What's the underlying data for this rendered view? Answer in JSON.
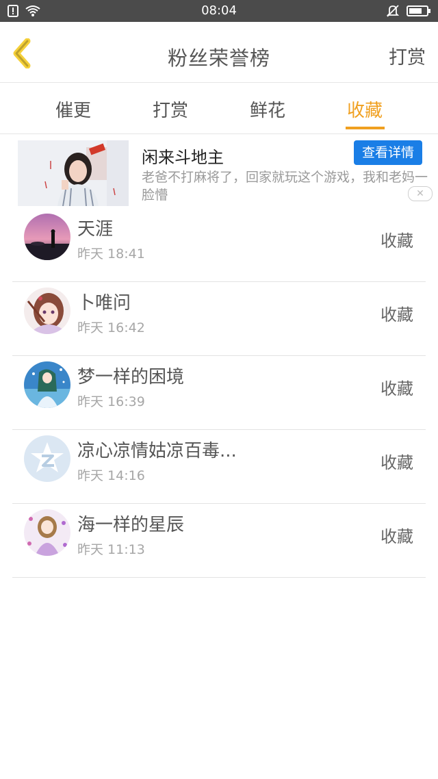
{
  "status_bar": {
    "time": "08:04"
  },
  "header": {
    "title": "粉丝荣誉榜",
    "right_action": "打赏"
  },
  "tabs": [
    {
      "label": "催更",
      "active": false
    },
    {
      "label": "打赏",
      "active": false
    },
    {
      "label": "鲜花",
      "active": false
    },
    {
      "label": "收藏",
      "active": true
    }
  ],
  "ad": {
    "title": "闲来斗地主",
    "button": "查看详情",
    "description": "老爸不打麻将了，回家就玩这个游戏，我和老妈一脸懵"
  },
  "list": [
    {
      "name": "天涯",
      "time": "昨天 18:41",
      "action": "收藏"
    },
    {
      "name": "卜唯问",
      "time": "昨天 16:42",
      "action": "收藏"
    },
    {
      "name": "梦一样的困境",
      "time": "昨天 16:39",
      "action": "收藏"
    },
    {
      "name": "凉心凉情姑凉百毒...",
      "time": "昨天 14:16",
      "action": "收藏"
    },
    {
      "name": "海一样的星辰",
      "time": "昨天 11:13",
      "action": "收藏"
    }
  ],
  "colors": {
    "accent": "#f0a020",
    "ad_button": "#1a7ee6",
    "status_bar": "#4b4b4b"
  }
}
